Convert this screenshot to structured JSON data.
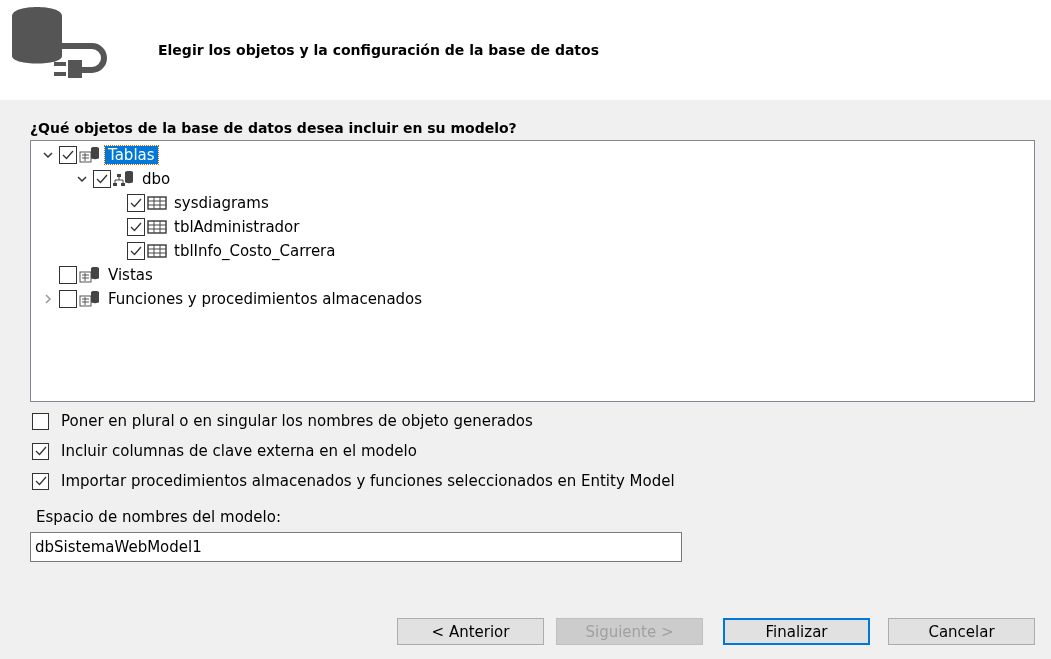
{
  "header": {
    "title": "Elegir los objetos y la configuración de la base de datos"
  },
  "tree": {
    "label": "¿Qué objetos de la base de datos desea incluir en su modelo?",
    "items": [
      {
        "kind": "group",
        "label": "Tablas",
        "checked": true,
        "selected": true,
        "expanded": true,
        "children": [
          {
            "kind": "schema",
            "label": "dbo",
            "checked": true,
            "selected": false,
            "expanded": true,
            "children": [
              {
                "kind": "table",
                "label": "sysdiagrams",
                "checked": true,
                "selected": false
              },
              {
                "kind": "table",
                "label": "tblAdministrador",
                "checked": true,
                "selected": false
              },
              {
                "kind": "table",
                "label": "tblInfo_Costo_Carrera",
                "checked": true,
                "selected": false
              }
            ]
          }
        ]
      },
      {
        "kind": "group",
        "label": "Vistas",
        "checked": false,
        "selected": false
      },
      {
        "kind": "group",
        "label": "Funciones y procedimientos almacenados",
        "checked": false,
        "selected": false,
        "expanded": false
      }
    ]
  },
  "options": [
    {
      "label": "Poner en plural o en singular los nombres de objeto generados",
      "checked": false
    },
    {
      "label": "Incluir columnas de clave externa en el modelo",
      "checked": true
    },
    {
      "label": "Importar procedimientos almacenados y funciones seleccionados en Entity Model",
      "checked": true
    }
  ],
  "namespace": {
    "label": "Espacio de nombres del modelo:",
    "value": "dbSistemaWebModel1"
  },
  "buttons": [
    {
      "label": "< Anterior",
      "disabled": false,
      "default": false
    },
    {
      "label": "Siguiente >",
      "disabled": true,
      "default": false
    },
    {
      "label": "Finalizar",
      "disabled": false,
      "default": true
    },
    {
      "label": "Cancelar",
      "disabled": false,
      "default": false
    }
  ]
}
